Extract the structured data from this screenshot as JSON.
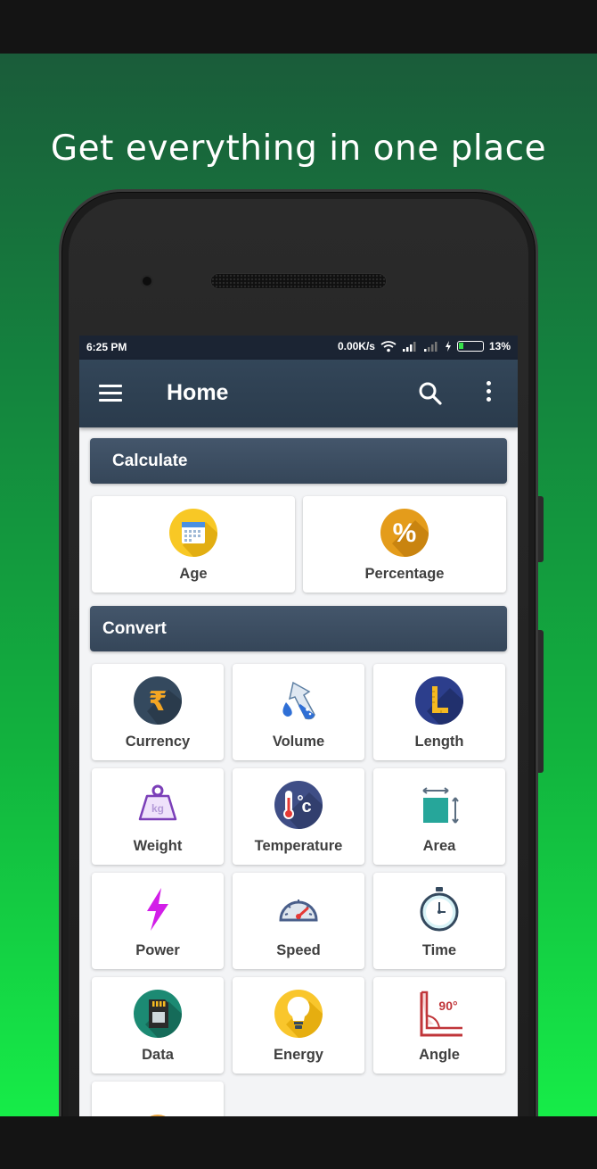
{
  "promo": {
    "headline": "Get everything in one place"
  },
  "status_bar": {
    "time": "6:25 PM",
    "network_speed": "0.00K/s",
    "battery": "13%"
  },
  "app_bar": {
    "title": "Home"
  },
  "sections": {
    "calculate": "Calculate",
    "convert": "Convert"
  },
  "calculate_items": [
    {
      "label": "Age",
      "icon": "calendar-icon"
    },
    {
      "label": "Percentage",
      "icon": "percent-icon"
    }
  ],
  "convert_items": [
    {
      "label": "Currency",
      "icon": "rupee-icon"
    },
    {
      "label": "Volume",
      "icon": "flask-icon"
    },
    {
      "label": "Length",
      "icon": "ruler-icon"
    },
    {
      "label": "Weight",
      "icon": "weight-icon"
    },
    {
      "label": "Temperature",
      "icon": "thermometer-icon"
    },
    {
      "label": "Area",
      "icon": "area-icon"
    },
    {
      "label": "Power",
      "icon": "lightning-icon"
    },
    {
      "label": "Speed",
      "icon": "speedometer-icon"
    },
    {
      "label": "Time",
      "icon": "stopwatch-icon"
    },
    {
      "label": "Data",
      "icon": "sd-card-icon"
    },
    {
      "label": "Energy",
      "icon": "bulb-icon"
    },
    {
      "label": "Angle",
      "icon": "angle-icon"
    }
  ],
  "colors": {
    "app_bar": "#2f4255",
    "section_header": "#3d4f63",
    "promo_gradient_top": "#1a5c3a",
    "promo_gradient_bottom": "#16ec48"
  }
}
